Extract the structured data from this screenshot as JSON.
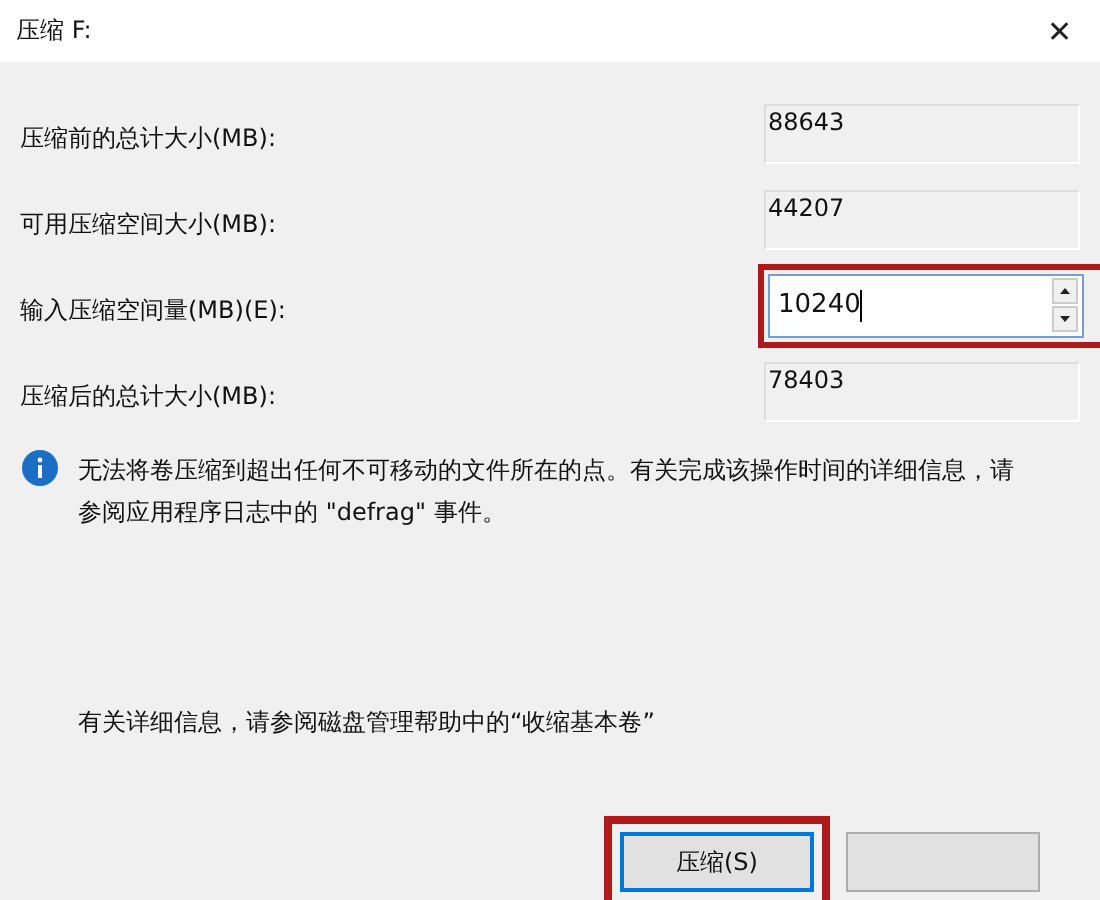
{
  "window": {
    "title": "压缩 F:",
    "close": "✕"
  },
  "fields": [
    {
      "label": "压缩前的总计大小(MB):",
      "value": "88643",
      "kind": "readonly",
      "highlighted": false
    },
    {
      "label": "可用压缩空间大小(MB):",
      "value": "44207",
      "kind": "readonly",
      "highlighted": false
    },
    {
      "label": "输入压缩空间量(MB)(E):",
      "value": "10240",
      "kind": "spin",
      "highlighted": true
    },
    {
      "label": "压缩后的总计大小(MB):",
      "value": "78403",
      "kind": "readonly",
      "highlighted": false
    }
  ],
  "info": "无法将卷压缩到超出任何不可移动的文件所在的点。有关完成该操作时间的详细信息，请参阅应用程序日志中的 \"defrag\" 事件。",
  "help": "有关详细信息，请参阅磁盘管理帮助中的“收缩基本卷”",
  "buttons": [
    {
      "label": "压缩(S)",
      "highlighted": true,
      "default": true
    },
    {
      "highlighted": false,
      "default": false
    }
  ]
}
